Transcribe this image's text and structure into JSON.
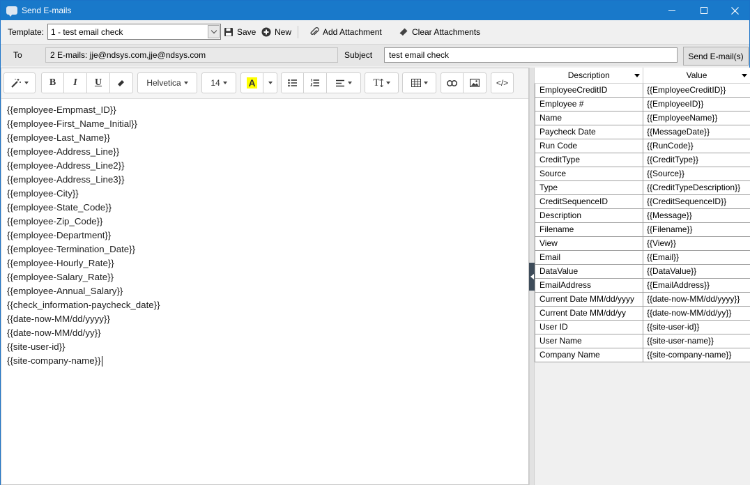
{
  "window": {
    "title": "Send E-mails"
  },
  "toolbar": {
    "template_label": "Template:",
    "template_value": "1 - test email check",
    "save_label": "Save",
    "new_label": "New",
    "add_attachment_label": "Add Attachment",
    "clear_attachments_label": "Clear Attachments"
  },
  "address": {
    "to_label": "To",
    "to_value": "2 E-mails: jje@ndsys.com,jje@ndsys.com",
    "subject_label": "Subject",
    "subject_value": "test email check",
    "send_label": "Send E-mail(s)"
  },
  "editor_toolbar": {
    "font_name": "Helvetica",
    "font_size": "14",
    "bold": "B",
    "italic": "I",
    "underline": "U",
    "highlight": "A",
    "code": "</>",
    "text_height": "T"
  },
  "editor": {
    "lines": [
      "{{employee-Empmast_ID}}",
      "{{employee-First_Name_Initial}}",
      "{{employee-Last_Name}}",
      "{{employee-Address_Line}}",
      "{{employee-Address_Line2}}",
      "{{employee-Address_Line3}}",
      "{{employee-City}}",
      "{{employee-State_Code}}",
      "{{employee-Zip_Code}}",
      "{{employee-Department}}",
      "{{employee-Termination_Date}}",
      "{{employee-Hourly_Rate}}",
      "{{employee-Salary_Rate}}",
      "{{employee-Annual_Salary}}",
      "{{check_information-paycheck_date}}",
      "{{date-now-MM/dd/yyyy}}",
      "{{date-now-MM/dd/yy}}",
      "{{site-user-id}}",
      "{{site-company-name}}"
    ]
  },
  "grid": {
    "columns": [
      "Description",
      "Value"
    ],
    "rows": [
      [
        "EmployeeCreditID",
        "{{EmployeeCreditID}}"
      ],
      [
        "Employee #",
        "{{EmployeeID}}"
      ],
      [
        "Name",
        "{{EmployeeName}}"
      ],
      [
        "Paycheck Date",
        "{{MessageDate}}"
      ],
      [
        "Run Code",
        "{{RunCode}}"
      ],
      [
        "CreditType",
        "{{CreditType}}"
      ],
      [
        "Source",
        "{{Source}}"
      ],
      [
        "Type",
        "{{CreditTypeDescription}}"
      ],
      [
        "CreditSequenceID",
        "{{CreditSequenceID}}"
      ],
      [
        "Description",
        "{{Message}}"
      ],
      [
        "Filename",
        "{{Filename}}"
      ],
      [
        "View",
        "{{View}}"
      ],
      [
        "Email",
        "{{Email}}"
      ],
      [
        "DataValue",
        "{{DataValue}}"
      ],
      [
        "EmailAddress",
        "{{EmailAddress}}"
      ],
      [
        "Current Date MM/dd/yyyy",
        "{{date-now-MM/dd/yyyy}}"
      ],
      [
        "Current Date MM/dd/yy",
        "{{date-now-MM/dd/yy}}"
      ],
      [
        "User ID",
        "{{site-user-id}}"
      ],
      [
        "User Name",
        "{{site-user-name}}"
      ],
      [
        "Company Name",
        "{{site-company-name}}"
      ]
    ]
  }
}
